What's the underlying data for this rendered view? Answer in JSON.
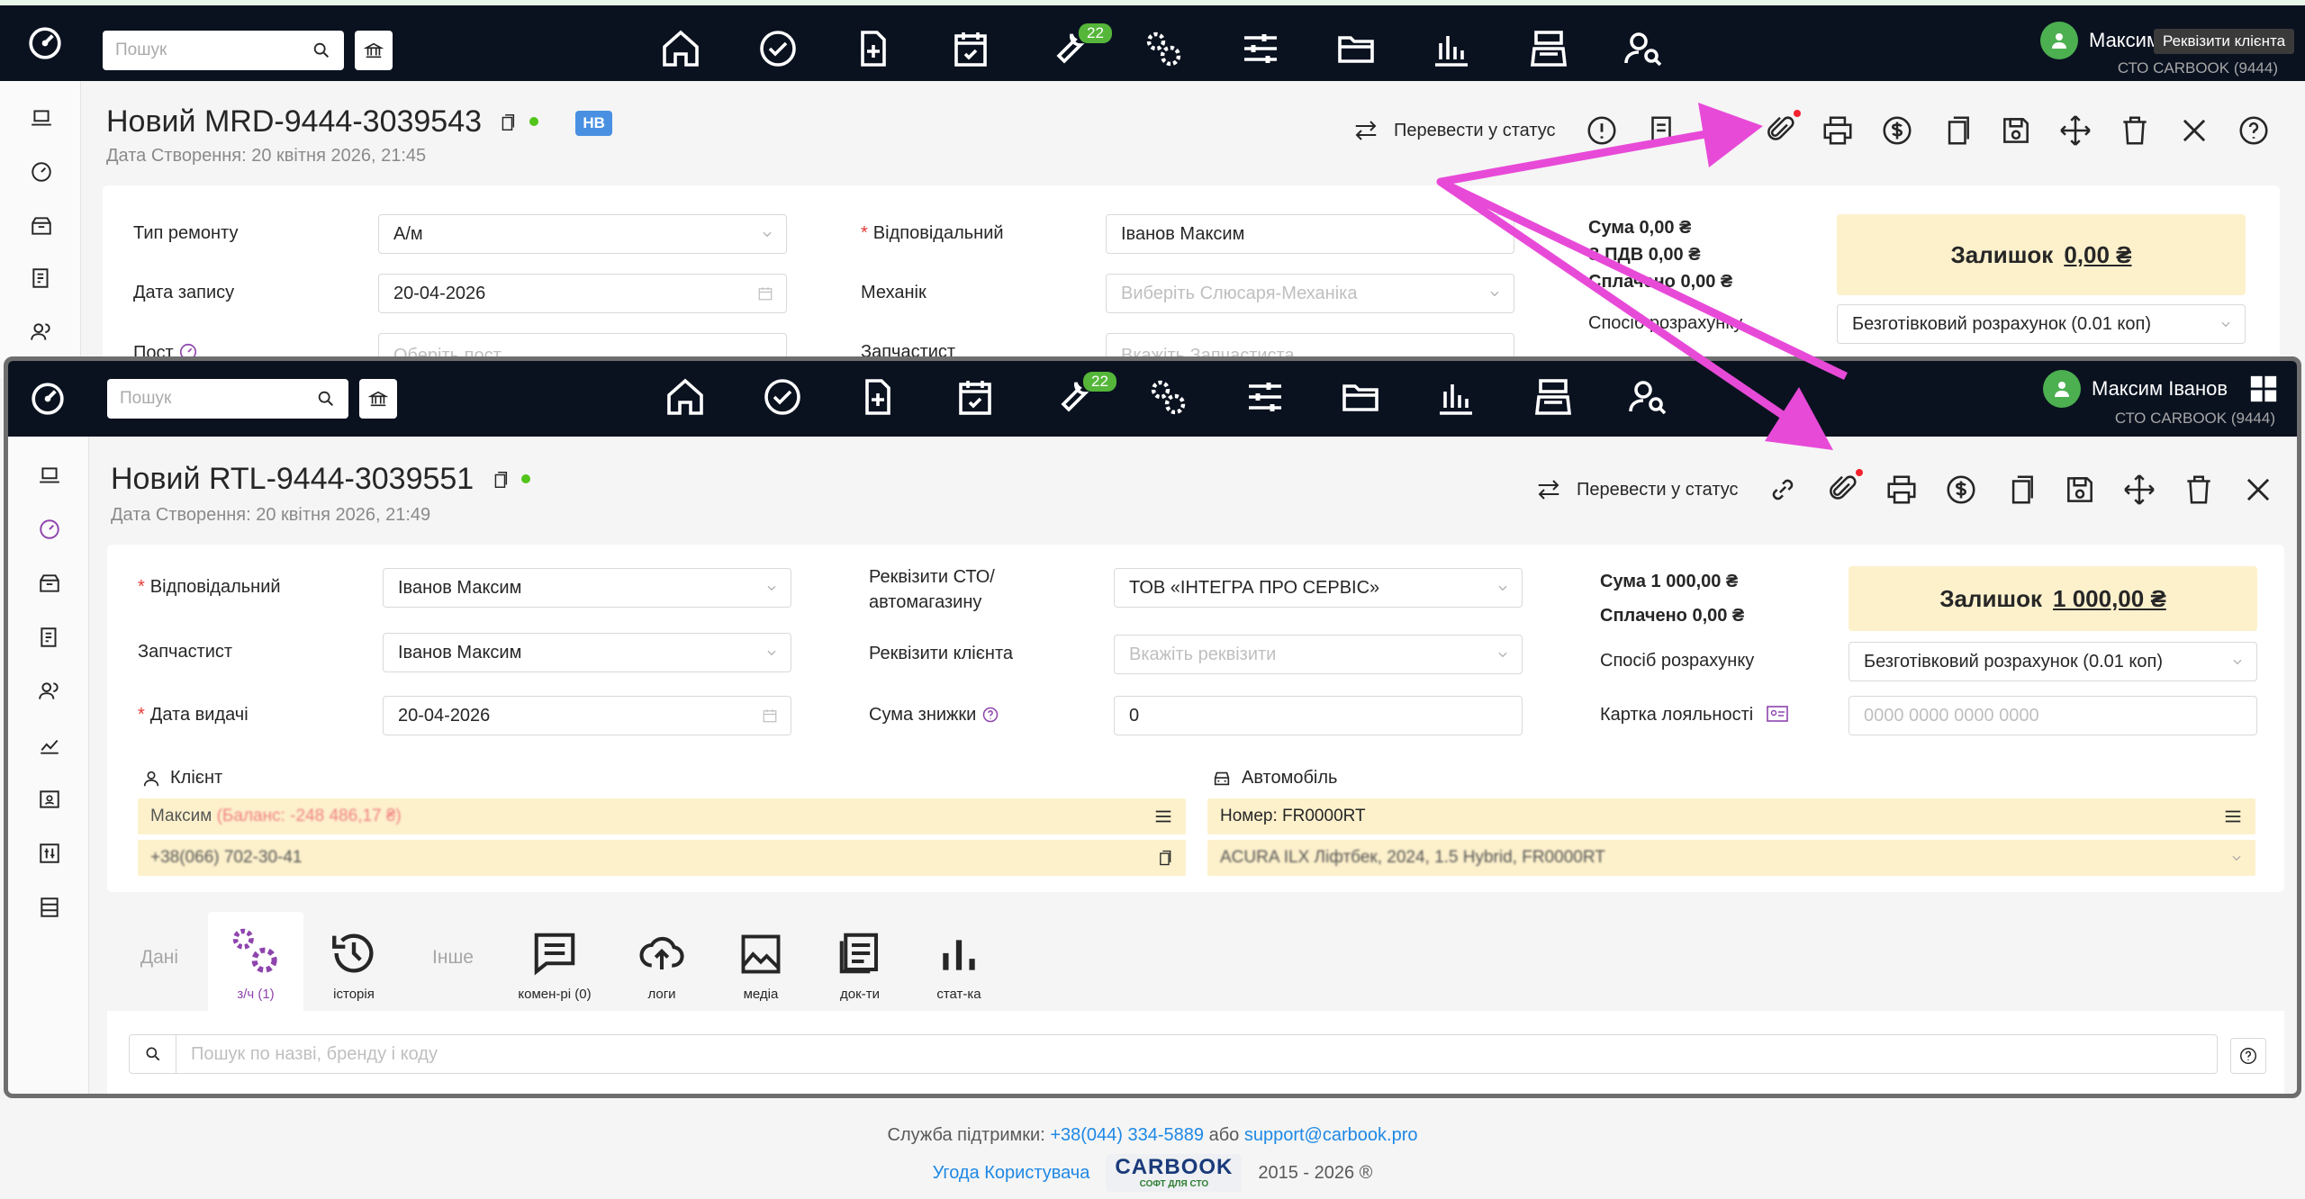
{
  "search_placeholder": "Пошук",
  "nav_badge": "22",
  "user": {
    "name": "Максим Іванов",
    "name_short": "Максим",
    "company": "СТО CARBOOK (9444)"
  },
  "tooltip": "Реквізити клієнта",
  "top": {
    "title": "Новий MRD-9444-3039543",
    "badge": "НВ",
    "created": "Дата Створення: 20 квітня 2026, 21:45",
    "status_button": "Перевести у статус",
    "repair_type_label": "Тип ремонту",
    "repair_type_value": "А/м",
    "record_date_label": "Дата запису",
    "record_date_value": "20-04-2026",
    "post_label": "Пост",
    "post_placeholder": "Оберіть пост",
    "responsible_label": "Відповідальний",
    "responsible_value": "Іванов Максим",
    "mechanic_label": "Механік",
    "mechanic_placeholder": "Виберіть Слюсаря-Механіка",
    "parts_label": "Запчастист",
    "parts_placeholder": "Вкажіть Запчастиста",
    "sum": "Сума  0,00 ₴",
    "vat": "З ПДВ  0,00 ₴",
    "paid": "Сплачено  0,00 ₴",
    "remainder_label": "Залишок",
    "remainder_value": "0,00 ₴",
    "payment_label": "Спосіб розрахунку",
    "payment_value": "Безготівковий розрахунок (0.01 коп)"
  },
  "bottom": {
    "title": "Новий RTL-9444-3039551",
    "created": "Дата Створення: 20 квітня 2026, 21:49",
    "status_button": "Перевести у статус",
    "responsible_label": "Відповідальний",
    "responsible_value": "Іванов Максим",
    "parts_label": "Запчастист",
    "parts_value": "Іванов Максим",
    "issue_date_label": "Дата видачі",
    "issue_date_value": "20-04-2026",
    "sto_req_label_1": "Реквізити СТО/",
    "sto_req_label_2": "автомагазину",
    "sto_req_value": "ТОВ «ІНТЕГРА ПРО СЕРВІС»",
    "client_req_label": "Реквізити клієнта",
    "client_req_placeholder": "Вкажіть реквізити",
    "discount_label": "Сума знижки",
    "discount_value": "0",
    "sum": "Сума  1 000,00 ₴",
    "paid": "Сплачено  0,00 ₴",
    "remainder_label": "Залишок",
    "remainder_value": "1 000,00 ₴",
    "payment_label": "Спосіб розрахунку",
    "payment_value": "Безготівковий розрахунок (0.01 коп)",
    "loyalty_label": "Картка лояльності",
    "loyalty_placeholder": "0000 0000 0000 0000",
    "client_header": "Клієнт",
    "client_name": "Максим",
    "client_balance": "(Баланс: -248 486,17 ₴)",
    "client_phone": "+38(066) 702-30-41",
    "car_header": "Автомобіль",
    "car_number": "Номер: FR0000RT",
    "car_desc": "ACURA ILX Ліфтбек, 2024, 1.5 Hybrid, FR0000RT",
    "tabs": {
      "data": "Дані",
      "parts": "з/ч (1)",
      "history": "історія",
      "other": "Інше",
      "comments": "комен-рі (0)",
      "logs": "логи",
      "media": "медіа",
      "docs": "док-ти",
      "stats": "стат-ка"
    },
    "parts_search_placeholder": "Пошук по назві, бренду і коду"
  },
  "footer": {
    "support_label": "Служба підтримки:",
    "phone": "+38(044) 334-5889",
    "or": "або",
    "email": "support@carbook.pro",
    "agreement": "Угода Користувача",
    "brand": "CARBOOK",
    "brand_sub": "СОФТ ДЛЯ СТО",
    "years": "2015 - 2026 ®"
  },
  "colors": {
    "nav_bg": "#0a1220",
    "accent_purple": "#8e44ad",
    "arrow": "#e84ad8",
    "remainder_bg": "#fdf1cc",
    "link": "#1e88e5"
  }
}
